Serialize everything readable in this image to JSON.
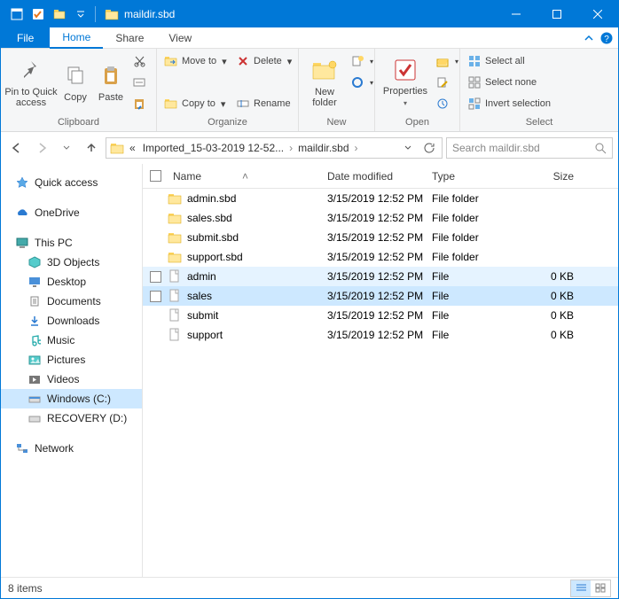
{
  "title": "maildir.sbd",
  "tabs": {
    "file": "File",
    "home": "Home",
    "share": "Share",
    "view": "View"
  },
  "ribbon": {
    "pin": "Pin to Quick\naccess",
    "copy": "Copy",
    "paste": "Paste",
    "clipboard_label": "Clipboard",
    "moveto": "Move to",
    "copyto": "Copy to",
    "delete": "Delete",
    "rename": "Rename",
    "organize_label": "Organize",
    "newfolder": "New\nfolder",
    "new_label": "New",
    "properties": "Properties",
    "open_label": "Open",
    "selectall": "Select all",
    "selectnone": "Select none",
    "invert": "Invert selection",
    "select_label": "Select"
  },
  "breadcrumb": {
    "seg1": "Imported_15-03-2019 12-52...",
    "seg2": "maildir.sbd"
  },
  "search": {
    "placeholder": "Search maildir.sbd"
  },
  "sidebar": {
    "quick": "Quick access",
    "onedrive": "OneDrive",
    "thispc": "This PC",
    "objects3d": "3D Objects",
    "desktop": "Desktop",
    "documents": "Documents",
    "downloads": "Downloads",
    "music": "Music",
    "pictures": "Pictures",
    "videos": "Videos",
    "cdrive": "Windows (C:)",
    "ddrive": "RECOVERY (D:)",
    "network": "Network"
  },
  "columns": {
    "name": "Name",
    "date": "Date modified",
    "type": "Type",
    "size": "Size"
  },
  "files": [
    {
      "name": "admin.sbd",
      "date": "3/15/2019 12:52 PM",
      "type": "File folder",
      "size": "",
      "icon": "folder",
      "state": ""
    },
    {
      "name": "sales.sbd",
      "date": "3/15/2019 12:52 PM",
      "type": "File folder",
      "size": "",
      "icon": "folder",
      "state": ""
    },
    {
      "name": "submit.sbd",
      "date": "3/15/2019 12:52 PM",
      "type": "File folder",
      "size": "",
      "icon": "folder",
      "state": ""
    },
    {
      "name": "support.sbd",
      "date": "3/15/2019 12:52 PM",
      "type": "File folder",
      "size": "",
      "icon": "folder",
      "state": ""
    },
    {
      "name": "admin",
      "date": "3/15/2019 12:52 PM",
      "type": "File",
      "size": "0 KB",
      "icon": "file",
      "state": "hov"
    },
    {
      "name": "sales",
      "date": "3/15/2019 12:52 PM",
      "type": "File",
      "size": "0 KB",
      "icon": "file",
      "state": "sel"
    },
    {
      "name": "submit",
      "date": "3/15/2019 12:52 PM",
      "type": "File",
      "size": "0 KB",
      "icon": "file",
      "state": ""
    },
    {
      "name": "support",
      "date": "3/15/2019 12:52 PM",
      "type": "File",
      "size": "0 KB",
      "icon": "file",
      "state": ""
    }
  ],
  "status": {
    "count": "8 items"
  }
}
